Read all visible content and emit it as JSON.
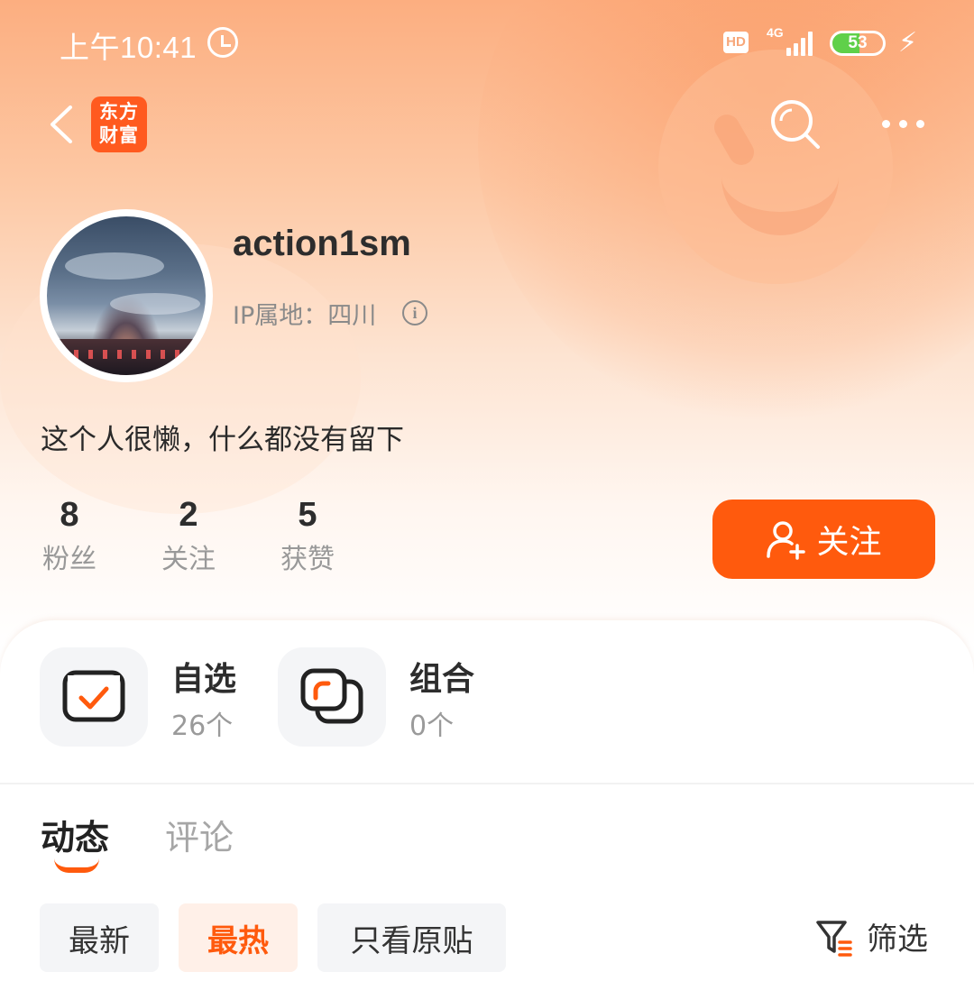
{
  "status_bar": {
    "time": "上午10:41",
    "hd": "HD",
    "network": "4G",
    "battery": "53",
    "battery_level": 0.53
  },
  "nav": {
    "brand_line1": "东方",
    "brand_line2": "财富"
  },
  "profile": {
    "username": "action1sm",
    "ip_location": "IP属地：四川",
    "bio": "这个人很懒，什么都没有留下"
  },
  "stats": [
    {
      "value": "8",
      "label": "粉丝"
    },
    {
      "value": "2",
      "label": "关注"
    },
    {
      "value": "5",
      "label": "获赞"
    }
  ],
  "follow_button": {
    "label": "关注"
  },
  "features": [
    {
      "title": "自选",
      "count": "26个"
    },
    {
      "title": "组合",
      "count": "0个"
    }
  ],
  "tabs": [
    {
      "label": "动态",
      "active": true
    },
    {
      "label": "评论",
      "active": false
    }
  ],
  "filters": [
    {
      "label": "最新",
      "active": false
    },
    {
      "label": "最热",
      "active": true
    },
    {
      "label": "只看原贴",
      "active": false
    }
  ],
  "filter_button": {
    "label": "筛选"
  },
  "colors": {
    "accent": "#ff5a0d",
    "hero_top": "#fcae80",
    "battery_green": "#5fd04a"
  },
  "icons": {
    "back": "chevron-left-icon",
    "search": "search-icon",
    "more": "more-icon",
    "info": "info-icon",
    "follow": "add-user-icon",
    "watchlist": "checkbox-icon",
    "portfolio": "layers-icon",
    "filter": "filter-icon"
  }
}
